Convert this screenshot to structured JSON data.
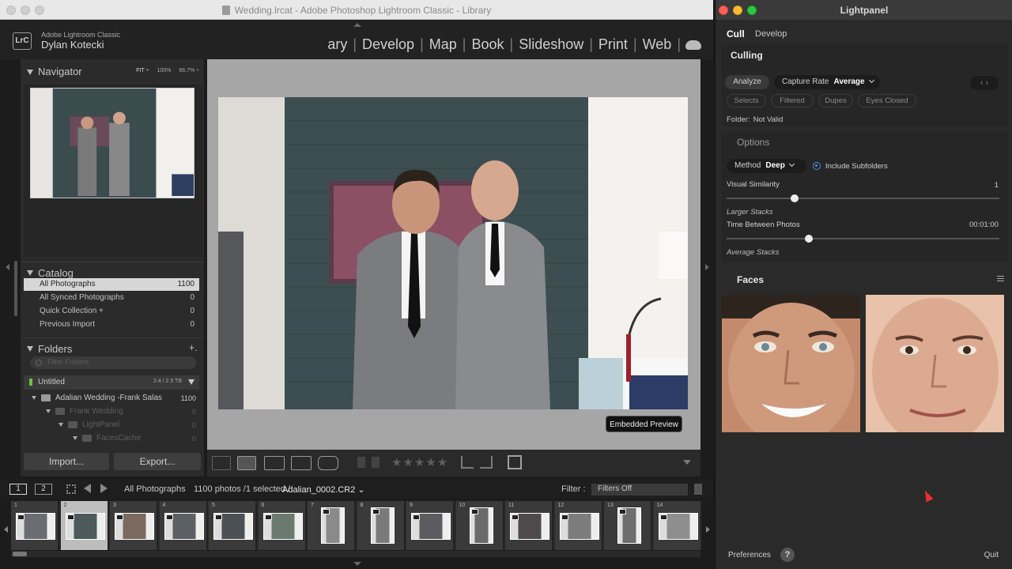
{
  "lightroom": {
    "window_title": "Wedding.lrcat - Adobe Photoshop Lightroom Classic - Library",
    "badge": "LrC",
    "app_name": "Adobe Lightroom Classic",
    "user": "Dylan Kotecki",
    "modules": [
      {
        "label": "ary"
      },
      {
        "label": "Develop"
      },
      {
        "label": "Map"
      },
      {
        "label": "Book"
      },
      {
        "label": "Slideshow"
      },
      {
        "label": "Print"
      },
      {
        "label": "Web"
      }
    ],
    "navigator": {
      "title": "Navigator",
      "zoom": [
        "FIT ÷",
        "100%",
        "66.7% ÷"
      ]
    },
    "catalog": {
      "title": "Catalog",
      "rows": [
        {
          "label": "All Photographs",
          "count": "1100"
        },
        {
          "label": "All Synced Photographs",
          "count": "0"
        },
        {
          "label": "Quick Collection +",
          "count": "0"
        },
        {
          "label": "Previous Import",
          "count": "0"
        }
      ]
    },
    "folders": {
      "title": "Folders",
      "add": "+.",
      "filter_placeholder": "Filter Folders",
      "volume": {
        "name": "Untitled",
        "size": "2.4 / 2.5 TB"
      },
      "tree": [
        {
          "name": "Adalian Wedding -Frank Salas",
          "count": "1100"
        },
        {
          "name": "Frank Wedding",
          "count": "0"
        },
        {
          "name": "LightPanel",
          "count": "0"
        },
        {
          "name": "FacesCache",
          "count": "0"
        }
      ]
    },
    "buttons": {
      "import": "Import...",
      "export": "Export..."
    },
    "preview_badge": "Embedded Preview",
    "toolbar": {
      "stars": "★★★★★"
    },
    "filmstrip": {
      "page1": "1",
      "page2": "2",
      "source": "All Photographs",
      "count": "1100 photos /1 selected /",
      "file": "Adalian_0002.CR2 ⌄",
      "filter_label": "Filter :",
      "filter_value": "Filters Off",
      "cells": [
        "1",
        "2",
        "3",
        "4",
        "5",
        "6",
        "7",
        "8",
        "9",
        "10",
        "11",
        "12",
        "13",
        "14"
      ]
    }
  },
  "lightpanel": {
    "title": "Lightpanel",
    "tabs": {
      "cull": "Cull",
      "develop": "Develop"
    },
    "culling": {
      "title": "Culling",
      "analyze": "Analyze",
      "capture_rate_label": "Capture Rate",
      "capture_rate_value": "Average",
      "nav": "‹  ›",
      "filters": [
        "Selects",
        "Filtered",
        "Dupes",
        "Eyes Closed"
      ],
      "folder_label": "Folder:",
      "folder_value": "Not Valid"
    },
    "options": {
      "title": "Options",
      "method_label": "Method",
      "method_value": "Deep",
      "include_subfolders": "Include Subfolders",
      "visual_similarity_label": "Visual Similarity",
      "visual_similarity_value": "1",
      "visual_similarity_fraction": 0.25,
      "larger_stacks": "Larger Stacks",
      "time_between_label": "Time Between Photos",
      "time_between_value": "00:01:00",
      "time_between_fraction": 0.3,
      "average_stacks": "Average Stacks"
    },
    "faces": {
      "title": "Faces"
    },
    "footer": {
      "preferences": "Preferences",
      "help": "?",
      "quit": "Quit"
    }
  }
}
